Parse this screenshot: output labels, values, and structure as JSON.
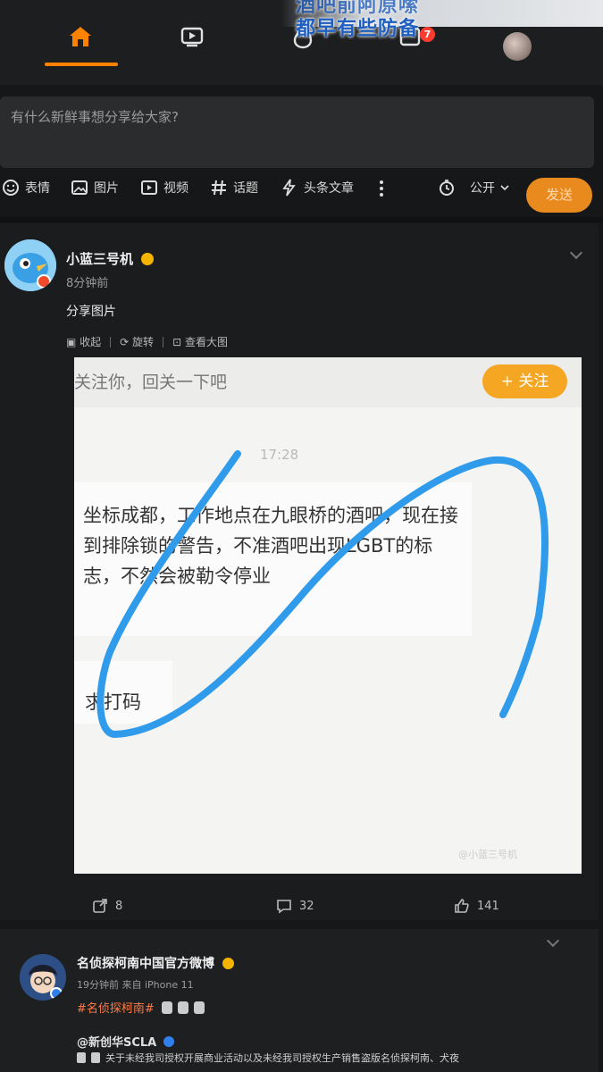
{
  "overlay_caption": {
    "line1": "酒吧前阿原嗦",
    "line2": "都早有些防备"
  },
  "topnav": {
    "items": [
      {
        "name": "home",
        "icon": "home-icon"
      },
      {
        "name": "video",
        "icon": "video-icon"
      },
      {
        "name": "hot",
        "icon": "flame-icon"
      },
      {
        "name": "messages",
        "icon": "message-icon",
        "badge": "7"
      },
      {
        "name": "profile",
        "icon": "avatar"
      }
    ],
    "accent": "#ff8200"
  },
  "composer": {
    "placeholder": "有什么新鲜事想分享给大家?",
    "tools": [
      {
        "icon": "emoji-icon",
        "label": "表情"
      },
      {
        "icon": "image-icon",
        "label": "图片"
      },
      {
        "icon": "video-icon",
        "label": "视频"
      },
      {
        "icon": "hashtag-icon",
        "label": "话题"
      },
      {
        "icon": "lightning-icon",
        "label": "头条文章"
      }
    ],
    "visibility": "公开",
    "send_label": "发送"
  },
  "post1": {
    "author": "小蓝三号机",
    "time": "8分钟前",
    "text": "分享图片",
    "media_tools": [
      "收起",
      "旋转",
      "查看大图"
    ],
    "image": {
      "follow_text": "关注你，回关一下吧",
      "follow_button": "+ 关注",
      "chat_time": "17:28",
      "message": "坐标成都，工作地点在九眼桥的酒吧，现在接到排除锁的警告，不准酒吧出现LGBT的标志，不然会被勒令停业",
      "message2": "求打码",
      "watermark": "@小蓝三号机"
    },
    "stats": {
      "reposts": "8",
      "comments": "32",
      "likes": "141"
    }
  },
  "post2": {
    "author": "名侦探柯南中国官方微博",
    "meta": "19分钟前 来自 iPhone 11",
    "tag": "#名侦探柯南#",
    "mention": "@新创华SCLA",
    "text": "关于未经我司授权开展商业活动以及未经我司授权生产销售盗版名侦探柯南、犬夜"
  }
}
